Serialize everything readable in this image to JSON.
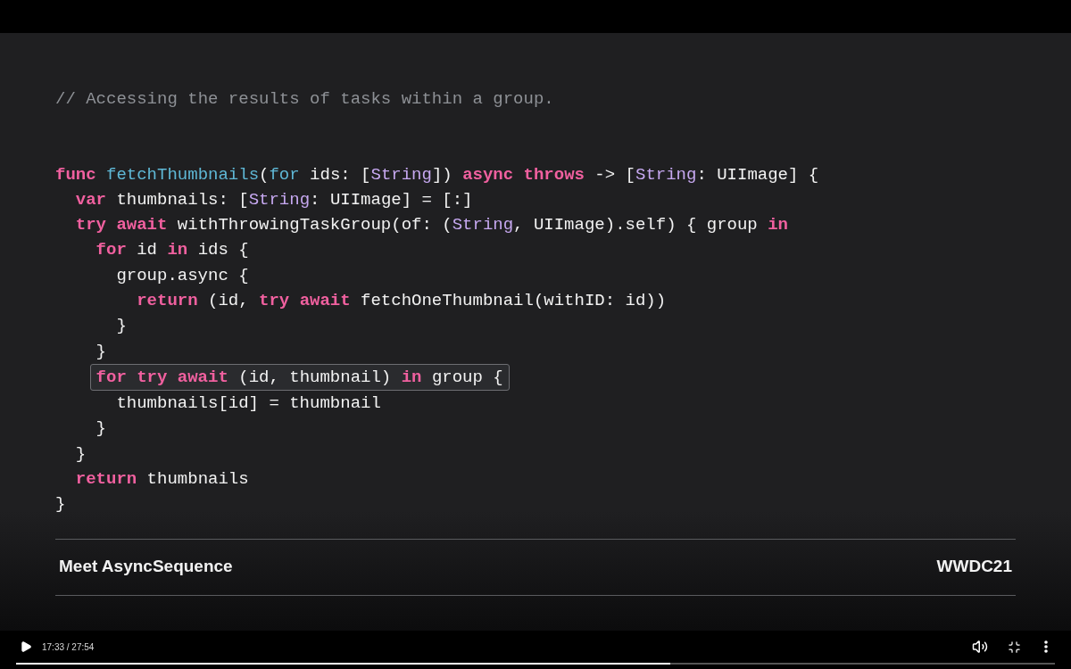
{
  "slide": {
    "comment": "// Accessing the results of tasks within a group.",
    "code_lines": [
      {
        "highlighted": false,
        "tokens": [
          {
            "kind": "keyword",
            "text": "func "
          },
          {
            "kind": "function",
            "text": "fetchThumbnails"
          },
          {
            "kind": "plain",
            "text": "("
          },
          {
            "kind": "function",
            "text": "for"
          },
          {
            "kind": "plain",
            "text": " ids: ["
          },
          {
            "kind": "type",
            "text": "String"
          },
          {
            "kind": "plain",
            "text": "]) "
          },
          {
            "kind": "keyword",
            "text": "async throws"
          },
          {
            "kind": "plain",
            "text": " -> ["
          },
          {
            "kind": "type",
            "text": "String"
          },
          {
            "kind": "plain",
            "text": ": UIImage] {"
          }
        ],
        "children": [
          {
            "highlighted": false,
            "tokens": [
              {
                "kind": "keyword",
                "text": "var"
              },
              {
                "kind": "plain",
                "text": " thumbnails: ["
              },
              {
                "kind": "type",
                "text": "String"
              },
              {
                "kind": "plain",
                "text": ": UIImage] = [:]"
              }
            ]
          },
          {
            "highlighted": false,
            "tokens": [
              {
                "kind": "keyword",
                "text": "try await"
              },
              {
                "kind": "plain",
                "text": " withThrowingTaskGroup(of: ("
              },
              {
                "kind": "type",
                "text": "String"
              },
              {
                "kind": "plain",
                "text": ", UIImage).self) { group "
              },
              {
                "kind": "keyword",
                "text": "in"
              }
            ],
            "children": [
              {
                "highlighted": false,
                "tokens": [
                  {
                    "kind": "keyword",
                    "text": "for"
                  },
                  {
                    "kind": "plain",
                    "text": " id "
                  },
                  {
                    "kind": "keyword",
                    "text": "in"
                  },
                  {
                    "kind": "plain",
                    "text": " ids {"
                  }
                ],
                "children": [
                  {
                    "highlighted": false,
                    "tokens": [
                      {
                        "kind": "plain",
                        "text": "group.async {"
                      }
                    ],
                    "children": [
                      {
                        "highlighted": false,
                        "tokens": [
                          {
                            "kind": "keyword",
                            "text": "return"
                          },
                          {
                            "kind": "plain",
                            "text": " (id, "
                          },
                          {
                            "kind": "keyword",
                            "text": "try await"
                          },
                          {
                            "kind": "plain",
                            "text": " fetchOneThumbnail(withID: id))"
                          }
                        ]
                      }
                    ]
                  },
                  {
                    "highlighted": false,
                    "tokens": [
                      {
                        "kind": "plain",
                        "text": "}"
                      }
                    ]
                  }
                ]
              },
              {
                "highlighted": false,
                "tokens": [
                  {
                    "kind": "plain",
                    "text": "}"
                  }
                ]
              },
              {
                "highlighted": true,
                "tokens": [
                  {
                    "kind": "keyword",
                    "text": "for try await"
                  },
                  {
                    "kind": "plain",
                    "text": " (id, thumbnail) "
                  },
                  {
                    "kind": "keyword",
                    "text": "in"
                  },
                  {
                    "kind": "plain",
                    "text": " group {"
                  }
                ],
                "children": [
                  {
                    "highlighted": false,
                    "tokens": [
                      {
                        "kind": "plain",
                        "text": "thumbnails[id] = thumbnail"
                      }
                    ]
                  }
                ]
              },
              {
                "highlighted": false,
                "tokens": [
                  {
                    "kind": "plain",
                    "text": "}"
                  }
                ]
              }
            ]
          },
          {
            "highlighted": false,
            "tokens": [
              {
                "kind": "plain",
                "text": "}"
              }
            ]
          },
          {
            "highlighted": false,
            "tokens": [
              {
                "kind": "keyword",
                "text": "return"
              },
              {
                "kind": "plain",
                "text": " thumbnails"
              }
            ]
          }
        ]
      },
      {
        "highlighted": false,
        "tokens": [
          {
            "kind": "plain",
            "text": "}"
          }
        ]
      }
    ],
    "footer_title": "Meet AsyncSequence",
    "footer_badge": "WWDC21"
  },
  "player": {
    "time": "17:33 / 27:54",
    "progress": {
      "level": 0.63
    }
  }
}
